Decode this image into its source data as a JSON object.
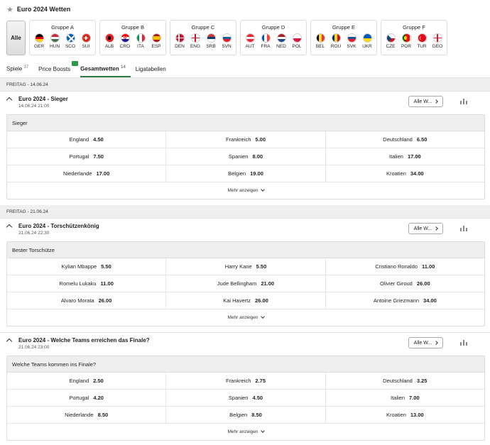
{
  "header": {
    "title": "Euro 2024 Wetten"
  },
  "groups": {
    "all_label": "Alle",
    "items": [
      {
        "title": "Gruppe A",
        "teams": [
          {
            "code": "GER",
            "flag": "de"
          },
          {
            "code": "HUN",
            "flag": "hu"
          },
          {
            "code": "SCO",
            "flag": "sco"
          },
          {
            "code": "SUI",
            "flag": "ch"
          }
        ]
      },
      {
        "title": "Gruppe B",
        "teams": [
          {
            "code": "ALB",
            "flag": "al"
          },
          {
            "code": "CRO",
            "flag": "hr"
          },
          {
            "code": "ITA",
            "flag": "it"
          },
          {
            "code": "ESP",
            "flag": "es"
          }
        ]
      },
      {
        "title": "Gruppe C",
        "teams": [
          {
            "code": "DEN",
            "flag": "dk"
          },
          {
            "code": "ENG",
            "flag": "en"
          },
          {
            "code": "SRB",
            "flag": "rs"
          },
          {
            "code": "SVN",
            "flag": "si"
          }
        ]
      },
      {
        "title": "Gruppe D",
        "teams": [
          {
            "code": "AUT",
            "flag": "at"
          },
          {
            "code": "FRA",
            "flag": "fr"
          },
          {
            "code": "NED",
            "flag": "nl"
          },
          {
            "code": "POL",
            "flag": "pl"
          }
        ]
      },
      {
        "title": "Gruppe E",
        "teams": [
          {
            "code": "BEL",
            "flag": "be"
          },
          {
            "code": "ROU",
            "flag": "ro"
          },
          {
            "code": "SVK",
            "flag": "sk"
          },
          {
            "code": "UKR",
            "flag": "ua"
          }
        ]
      },
      {
        "title": "Gruppe F",
        "teams": [
          {
            "code": "CZE",
            "flag": "cz"
          },
          {
            "code": "POR",
            "flag": "pt"
          },
          {
            "code": "TUR",
            "flag": "tr"
          },
          {
            "code": "GEO",
            "flag": "ge"
          }
        ]
      }
    ]
  },
  "tabs": [
    {
      "label": "Spiele",
      "count": "37",
      "active": false
    },
    {
      "label": "Price Boosts",
      "count": "",
      "active": false,
      "badge": true
    },
    {
      "label": "Gesamtwetten",
      "count": "14",
      "active": true
    },
    {
      "label": "Ligatabellen",
      "count": "",
      "active": false
    }
  ],
  "icons": {
    "star": "star-icon",
    "caret": "chevron-up-icon",
    "stats": "stats-icon",
    "more": "chevron-down-icon"
  },
  "colors": {
    "accent_green": "#2a7d3c",
    "badge_green": "#2d9b45"
  },
  "sections": [
    {
      "date_label": "FREITAG - 14.06.24",
      "markets": [
        {
          "title": "Euro 2024 - Sieger",
          "datetime": "14.06.24 21:00",
          "all_button": "Alle W...",
          "subheader": "Sieger",
          "more_label": "Mehr anzeigen",
          "rows": [
            [
              {
                "name": "England",
                "odd": "4.50"
              },
              {
                "name": "Frankreich",
                "odd": "5.00"
              },
              {
                "name": "Deutschland",
                "odd": "6.50"
              }
            ],
            [
              {
                "name": "Portugal",
                "odd": "7.50"
              },
              {
                "name": "Spanien",
                "odd": "8.00"
              },
              {
                "name": "Italien",
                "odd": "17.00"
              }
            ],
            [
              {
                "name": "Niederlande",
                "odd": "17.00"
              },
              {
                "name": "Belgien",
                "odd": "19.00"
              },
              {
                "name": "Kroatien",
                "odd": "34.00"
              }
            ]
          ]
        }
      ]
    },
    {
      "date_label": "FREITAG - 21.06.24",
      "markets": [
        {
          "title": "Euro 2024 - Torschützenkönig",
          "datetime": "21.06.24 22:30",
          "all_button": "Alle W...",
          "subheader": "Bester Torschütze",
          "more_label": "Mehr anzeigen",
          "rows": [
            [
              {
                "name": "Kylian Mbappe",
                "odd": "5.50"
              },
              {
                "name": "Harry Kane",
                "odd": "5.50"
              },
              {
                "name": "Cristiano Ronaldo",
                "odd": "11.00"
              }
            ],
            [
              {
                "name": "Romelu Lukaku",
                "odd": "11.00"
              },
              {
                "name": "Jude Bellingham",
                "odd": "21.00"
              },
              {
                "name": "Olivier Giroud",
                "odd": "26.00"
              }
            ],
            [
              {
                "name": "Alvaro Morata",
                "odd": "26.00"
              },
              {
                "name": "Kai Havertz",
                "odd": "26.00"
              },
              {
                "name": "Antoine Griezmann",
                "odd": "34.00"
              }
            ]
          ]
        },
        {
          "title": "Euro 2024 - Welche Teams erreichen das Finale?",
          "datetime": "21.06.24 23:00",
          "all_button": "Alle W...",
          "subheader": "Welche Teams kommen ins Finale?",
          "more_label": "Mehr anzeigen",
          "rows": [
            [
              {
                "name": "England",
                "odd": "2.50"
              },
              {
                "name": "Frankreich",
                "odd": "2.75"
              },
              {
                "name": "Deutschland",
                "odd": "3.25"
              }
            ],
            [
              {
                "name": "Portugal",
                "odd": "4.20"
              },
              {
                "name": "Spanien",
                "odd": "4.50"
              },
              {
                "name": "Italien",
                "odd": "7.00"
              }
            ],
            [
              {
                "name": "Niederlande",
                "odd": "8.50"
              },
              {
                "name": "Belgien",
                "odd": "8.50"
              },
              {
                "name": "Kroatien",
                "odd": "13.00"
              }
            ]
          ]
        }
      ]
    }
  ]
}
